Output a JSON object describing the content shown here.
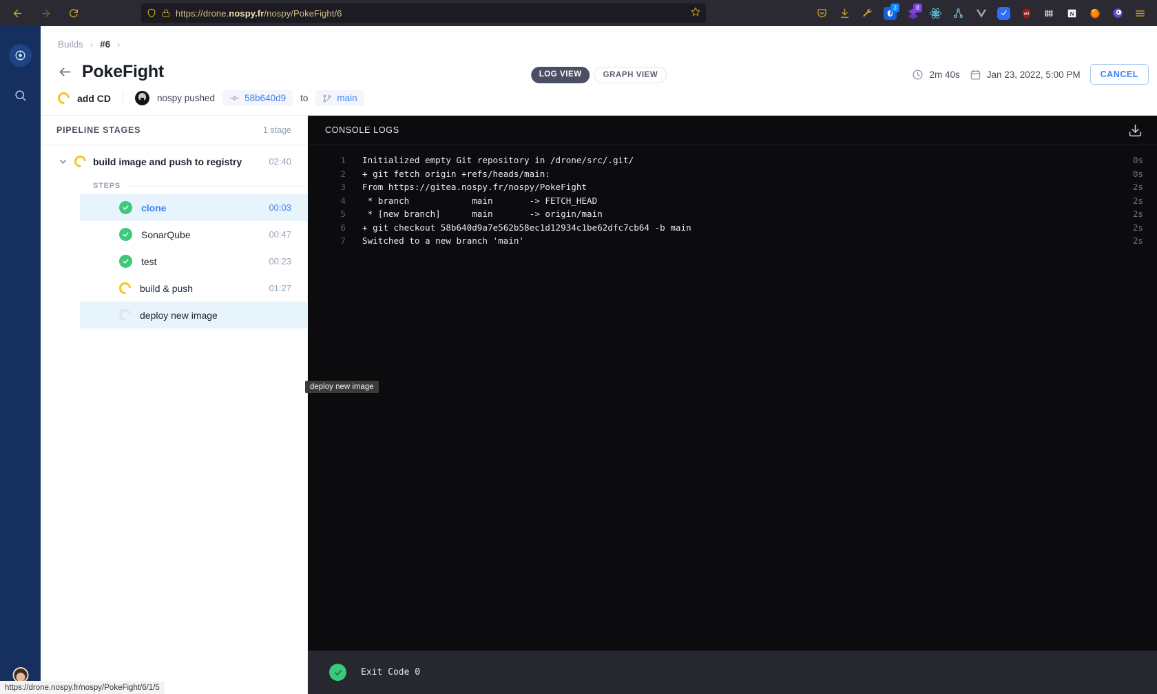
{
  "browser": {
    "back_icon": "back-arrow-icon",
    "forward_icon": "forward-arrow-icon",
    "reload_icon": "reload-icon",
    "shield_icon": "shield-icon",
    "lock_icon": "lock-icon",
    "url_prefix": "https://drone.",
    "url_domain": "nospy.fr",
    "url_suffix": "/nospy/PokeFight/6",
    "bookmark_icon": "star-icon",
    "extensions": [
      {
        "name": "pocket-icon",
        "badge": null
      },
      {
        "name": "downloads-icon",
        "badge": null
      },
      {
        "name": "wrench-icon",
        "badge": null
      },
      {
        "name": "bitwarden-icon",
        "badge": "3"
      },
      {
        "name": "layers-icon",
        "badge": "8"
      },
      {
        "name": "react-devtools-icon",
        "badge": null
      },
      {
        "name": "graph-icon",
        "badge": null
      },
      {
        "name": "vuejs-devtools-icon",
        "badge": null
      },
      {
        "name": "grammarly-icon",
        "badge": null
      },
      {
        "name": "ublock-origin-icon",
        "badge": null
      },
      {
        "name": "barcode-icon",
        "badge": null
      },
      {
        "name": "notion-icon",
        "badge": null
      },
      {
        "name": "firefox-account-icon",
        "badge": null
      },
      {
        "name": "profile-icon",
        "badge": null
      },
      {
        "name": "menu-icon",
        "badge": null
      }
    ]
  },
  "header": {
    "breadcrumb": {
      "root": "Builds",
      "build": "#6"
    },
    "back_icon": "back-arrow-icon",
    "title": "PokeFight",
    "status_icon": "running-spinner-icon",
    "commit_message": "add CD",
    "avatar_icon": "user-avatar",
    "author_action": "nospy pushed",
    "commit_icon": "commit-icon",
    "commit_sha": "58b640d9",
    "to_label": "to",
    "branch_icon": "branch-icon",
    "branch": "main",
    "tabs": [
      {
        "label": "LOG VIEW",
        "active": true
      },
      {
        "label": "GRAPH VIEW",
        "active": false
      }
    ],
    "clock_icon": "clock-icon",
    "duration": "2m 40s",
    "calendar_icon": "calendar-icon",
    "timestamp": "Jan 23, 2022, 5:00 PM",
    "cancel_label": "CANCEL"
  },
  "stages_panel": {
    "heading": "PIPELINE STAGES",
    "count_label": "1 stage",
    "stage": {
      "caret_icon": "chevron-down-icon",
      "status_icon": "running-spinner-icon",
      "name": "build image and push to registry",
      "duration": "02:40"
    },
    "steps_label": "STEPS",
    "steps": [
      {
        "name": "clone",
        "duration": "00:03",
        "status": "success",
        "selected": true
      },
      {
        "name": "SonarQube",
        "duration": "00:47",
        "status": "success",
        "selected": false
      },
      {
        "name": "test",
        "duration": "00:23",
        "status": "success",
        "selected": false
      },
      {
        "name": "build & push",
        "duration": "01:27",
        "status": "running",
        "selected": false
      },
      {
        "name": "deploy new image",
        "duration": "",
        "status": "pending",
        "selected": true
      }
    ]
  },
  "console": {
    "heading": "CONSOLE LOGS",
    "download_icon": "download-icon",
    "lines": [
      {
        "n": "1",
        "text": "Initialized empty Git repository in /drone/src/.git/",
        "d": "0s"
      },
      {
        "n": "2",
        "text": "+ git fetch origin +refs/heads/main:",
        "d": "0s"
      },
      {
        "n": "3",
        "text": "From https://gitea.nospy.fr/nospy/PokeFight",
        "d": "2s"
      },
      {
        "n": "4",
        "text": " * branch            main       -> FETCH_HEAD",
        "d": "2s"
      },
      {
        "n": "5",
        "text": " * [new branch]      main       -> origin/main",
        "d": "2s"
      },
      {
        "n": "6",
        "text": "+ git checkout 58b640d9a7e562b58ec1d12934c1be62dfc7cb64 -b main",
        "d": "2s"
      },
      {
        "n": "7",
        "text": "Switched to a new branch 'main'",
        "d": "2s"
      }
    ],
    "exit_icon": "success-check-icon",
    "exit_text": "Exit Code 0"
  },
  "tooltip": "deploy new image",
  "statusbar": "https://drone.nospy.fr/nospy/PokeFight/6/1/5",
  "colors": {
    "accent_blue": "#3b82f6",
    "success_green": "#3ec97a",
    "running_yellow": "#f5c518",
    "rail_navy": "#15305e",
    "console_bg": "#0c0c0f"
  }
}
